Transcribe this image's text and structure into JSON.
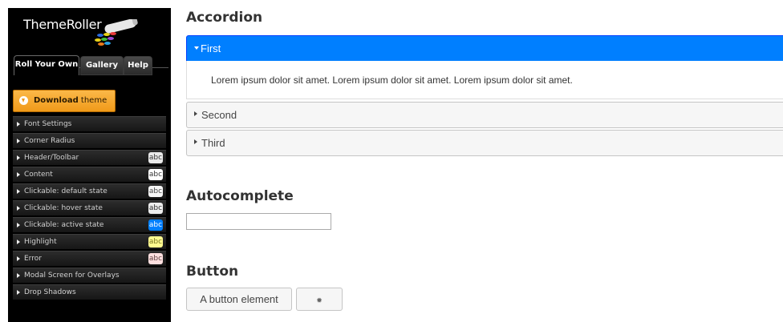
{
  "sidebar": {
    "logo_text": "ThemeRoller",
    "tabs": [
      "Roll Your Own",
      "Gallery",
      "Help"
    ],
    "download": {
      "strong": "Download",
      "rest": " theme"
    },
    "sections": [
      {
        "label": "Font Settings",
        "swatch": null
      },
      {
        "label": "Corner Radius",
        "swatch": null
      },
      {
        "label": "Header/Toolbar",
        "swatch": "abc"
      },
      {
        "label": "Content",
        "swatch": "abc"
      },
      {
        "label": "Clickable: default state",
        "swatch": "abc"
      },
      {
        "label": "Clickable: hover state",
        "swatch": "abc"
      },
      {
        "label": "Clickable: active state",
        "swatch": "abc"
      },
      {
        "label": "Highlight",
        "swatch": "abc"
      },
      {
        "label": "Error",
        "swatch": "abc"
      },
      {
        "label": "Modal Screen for Overlays",
        "swatch": null
      },
      {
        "label": "Drop Shadows",
        "swatch": null
      }
    ],
    "swatch_colors": {
      "header": {
        "bg": "#e9e9e9",
        "fg": "#333333"
      },
      "content": {
        "bg": "#ffffff",
        "fg": "#333333"
      },
      "default": {
        "bg": "#f6f6f6",
        "fg": "#454545"
      },
      "hover": {
        "bg": "#ededed",
        "fg": "#2b2b2b"
      },
      "active": {
        "bg": "#007fff",
        "fg": "#ffffff"
      },
      "highlight": {
        "bg": "#fffa90",
        "fg": "#777620"
      },
      "error": {
        "bg": "#fddfdf",
        "fg": "#5f3f3f"
      }
    }
  },
  "main": {
    "accordion": {
      "heading": "Accordion",
      "items": [
        "First",
        "Second",
        "Third"
      ],
      "content": "Lorem ipsum dolor sit amet. Lorem ipsum dolor sit amet. Lorem ipsum dolor sit amet."
    },
    "autocomplete": {
      "heading": "Autocomplete",
      "value": ""
    },
    "button": {
      "heading": "Button",
      "label": "A button element",
      "icon": "gear-icon"
    }
  },
  "colors": {
    "active_accent": "#007fff",
    "download_orange": "#f6a828"
  }
}
